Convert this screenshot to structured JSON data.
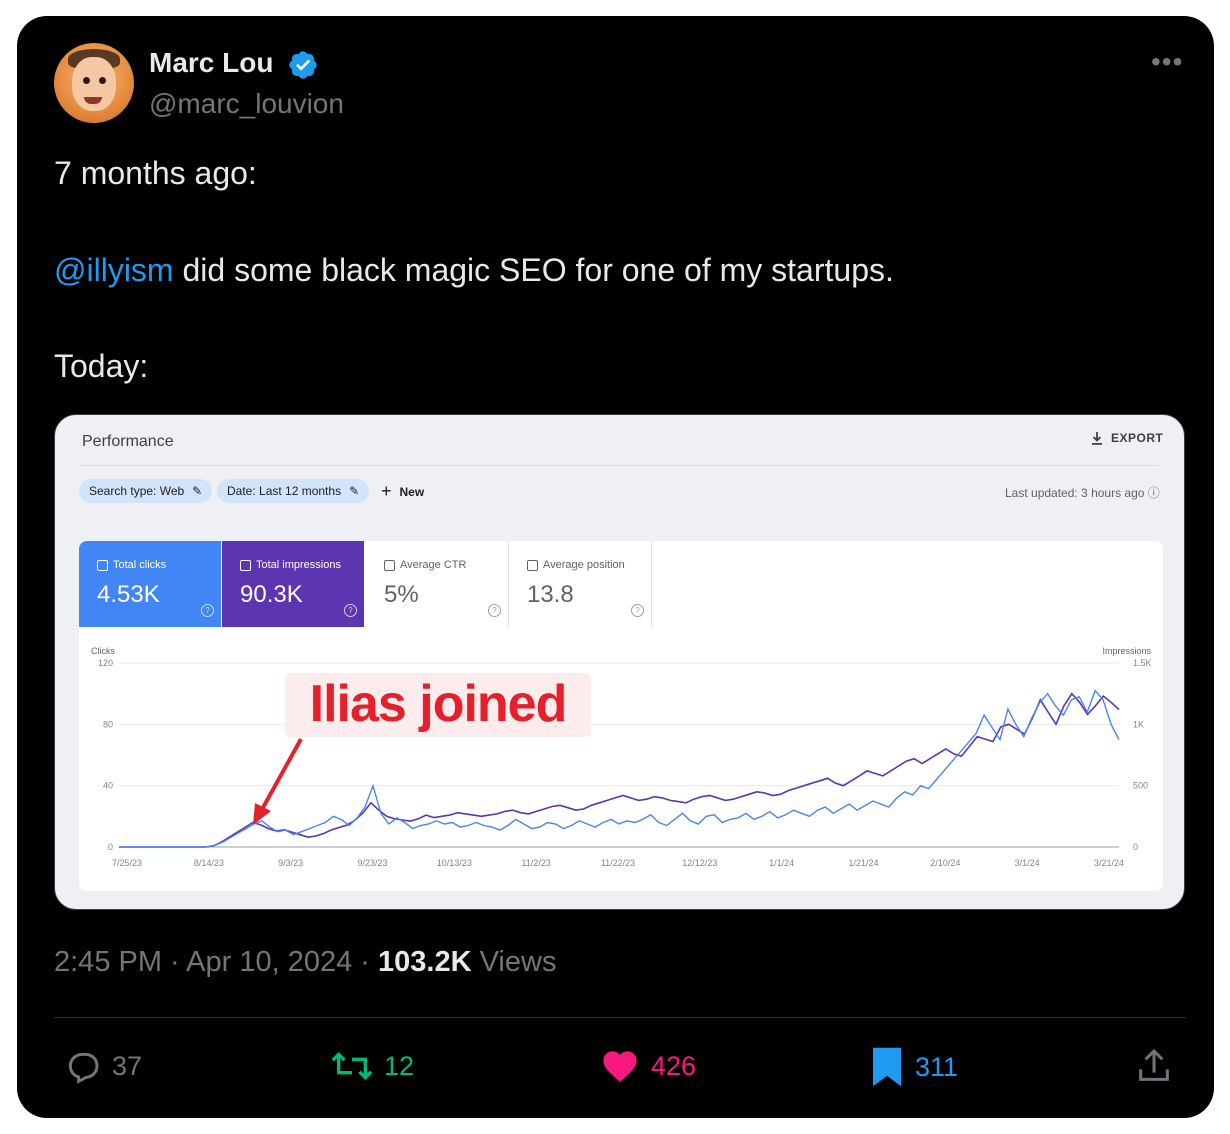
{
  "tweet": {
    "author_name": "Marc Lou",
    "author_handle": "@marc_louvion",
    "more_label": "•••",
    "line1": "7 months ago:",
    "mention": "@illyism",
    "line2_rest": " did some black magic SEO for one of my startups.",
    "line3": "Today:",
    "time": "2:45 PM",
    "date": "Apr 10, 2024",
    "views_count": "103.2K",
    "views_label": "Views",
    "replies": "37",
    "retweets": "12",
    "likes": "426",
    "bookmarks": "311",
    "colors": {
      "mention": "#1d9bf0",
      "retweet": "#00ba7c",
      "like": "#f91880",
      "bookmark": "#1d9bf0"
    }
  },
  "screenshot": {
    "title": "Performance",
    "export_label": "EXPORT",
    "filters": [
      "Search type: Web",
      "Date: Last 12 months"
    ],
    "new_label": "New",
    "last_updated": "Last updated: 3 hours ago",
    "metrics": [
      {
        "label": "Total clicks",
        "value": "4.53K",
        "checked": true,
        "color": "#4285f4"
      },
      {
        "label": "Total impressions",
        "value": "90.3K",
        "checked": true,
        "color": "#5e35b1"
      },
      {
        "label": "Average CTR",
        "value": "5%",
        "checked": false
      },
      {
        "label": "Average position",
        "value": "13.8",
        "checked": false
      }
    ],
    "annotation": "Ilias joined"
  },
  "chart_data": {
    "type": "line",
    "y_left_label": "Clicks",
    "y_right_label": "Impressions",
    "y_left_ticks": [
      "120",
      "80",
      "40",
      "0"
    ],
    "y_right_ticks": [
      "1.5K",
      "1K",
      "500",
      "0"
    ],
    "ylim_left": [
      0,
      120
    ],
    "ylim_right": [
      0,
      1500
    ],
    "x_tick_labels": [
      "7/25/23",
      "8/14/23",
      "9/3/23",
      "9/23/23",
      "10/13/23",
      "11/2/23",
      "11/22/23",
      "12/12/23",
      "1/1/24",
      "1/21/24",
      "2/10/24",
      "3/1/24",
      "3/21/24"
    ],
    "series": [
      {
        "name": "Clicks",
        "color": "#4a86e8",
        "axis": "left",
        "values": [
          0,
          0,
          0,
          0,
          0,
          0,
          0,
          0,
          0,
          0,
          0,
          0,
          1,
          3,
          6,
          9,
          12,
          15,
          17,
          13,
          10,
          11,
          8,
          10,
          12,
          14,
          16,
          20,
          18,
          14,
          19,
          26,
          40,
          22,
          15,
          19,
          16,
          12,
          14,
          15,
          17,
          15,
          16,
          13,
          14,
          16,
          14,
          13,
          11,
          14,
          18,
          15,
          12,
          13,
          16,
          15,
          12,
          14,
          17,
          15,
          13,
          16,
          18,
          15,
          17,
          16,
          18,
          21,
          16,
          14,
          18,
          22,
          17,
          15,
          20,
          21,
          16,
          18,
          19,
          22,
          18,
          20,
          23,
          19,
          21,
          24,
          22,
          20,
          24,
          26,
          22,
          25,
          28,
          24,
          27,
          30,
          28,
          26,
          32,
          36,
          34,
          40,
          38,
          44,
          50,
          56,
          62,
          68,
          74,
          86,
          78,
          70,
          90,
          80,
          72,
          84,
          94,
          100,
          92,
          86,
          96,
          98,
          88,
          102,
          96,
          80,
          70
        ]
      },
      {
        "name": "Impressions",
        "color": "#5e35b1",
        "axis": "right",
        "values": [
          0,
          0,
          0,
          0,
          0,
          0,
          0,
          0,
          0,
          0,
          0,
          0,
          10,
          40,
          80,
          120,
          160,
          200,
          180,
          150,
          130,
          140,
          120,
          100,
          80,
          90,
          110,
          140,
          160,
          180,
          220,
          280,
          360,
          300,
          250,
          230,
          220,
          210,
          230,
          260,
          240,
          250,
          260,
          280,
          270,
          260,
          250,
          260,
          270,
          290,
          300,
          280,
          270,
          290,
          310,
          330,
          340,
          320,
          300,
          310,
          340,
          360,
          380,
          400,
          420,
          400,
          380,
          390,
          410,
          400,
          380,
          370,
          360,
          390,
          410,
          420,
          400,
          380,
          390,
          410,
          430,
          450,
          440,
          420,
          430,
          460,
          480,
          500,
          520,
          540,
          560,
          520,
          500,
          540,
          580,
          620,
          600,
          580,
          620,
          660,
          700,
          720,
          680,
          720,
          760,
          800,
          760,
          740,
          820,
          900,
          880,
          860,
          980,
          1000,
          960,
          920,
          1050,
          1200,
          1100,
          1000,
          1150,
          1250,
          1180,
          1080,
          1150,
          1230,
          1180,
          1120
        ]
      }
    ]
  }
}
